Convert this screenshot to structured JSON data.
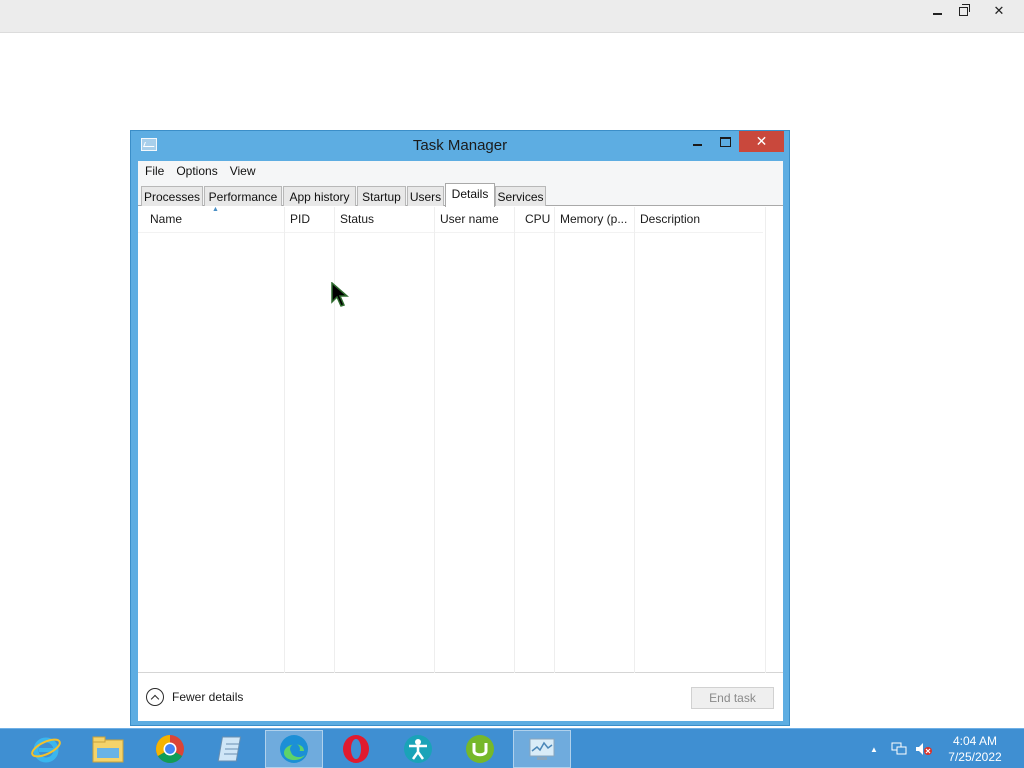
{
  "window": {
    "title": "Task Manager",
    "close_symbol": "✕"
  },
  "menu": [
    "File",
    "Options",
    "View"
  ],
  "tabs": [
    "Processes",
    "Performance",
    "App history",
    "Startup",
    "Users",
    "Details",
    "Services"
  ],
  "active_tab": "Details",
  "columns": [
    "Name",
    "PID",
    "Status",
    "User name",
    "CPU",
    "Memory (p...",
    "Description"
  ],
  "sorted_column": "Name",
  "footer": {
    "fewer_details": "Fewer details",
    "end_task": "End task"
  },
  "taskbar": {
    "apps": [
      "internet-explorer-icon",
      "file-explorer-icon",
      "chrome-icon",
      "notepad-icon",
      "edge-icon",
      "opera-icon",
      "accessibility-app-icon",
      "utorrent-icon",
      "task-manager-icon"
    ],
    "active_apps": [
      "edge-icon",
      "task-manager-icon"
    ],
    "clock_time": "4:04 AM",
    "clock_date": "7/25/2022"
  },
  "colors": {
    "window_frame": "#5dade2",
    "close_button": "#c9483c",
    "taskbar": "#3f8fd2"
  }
}
